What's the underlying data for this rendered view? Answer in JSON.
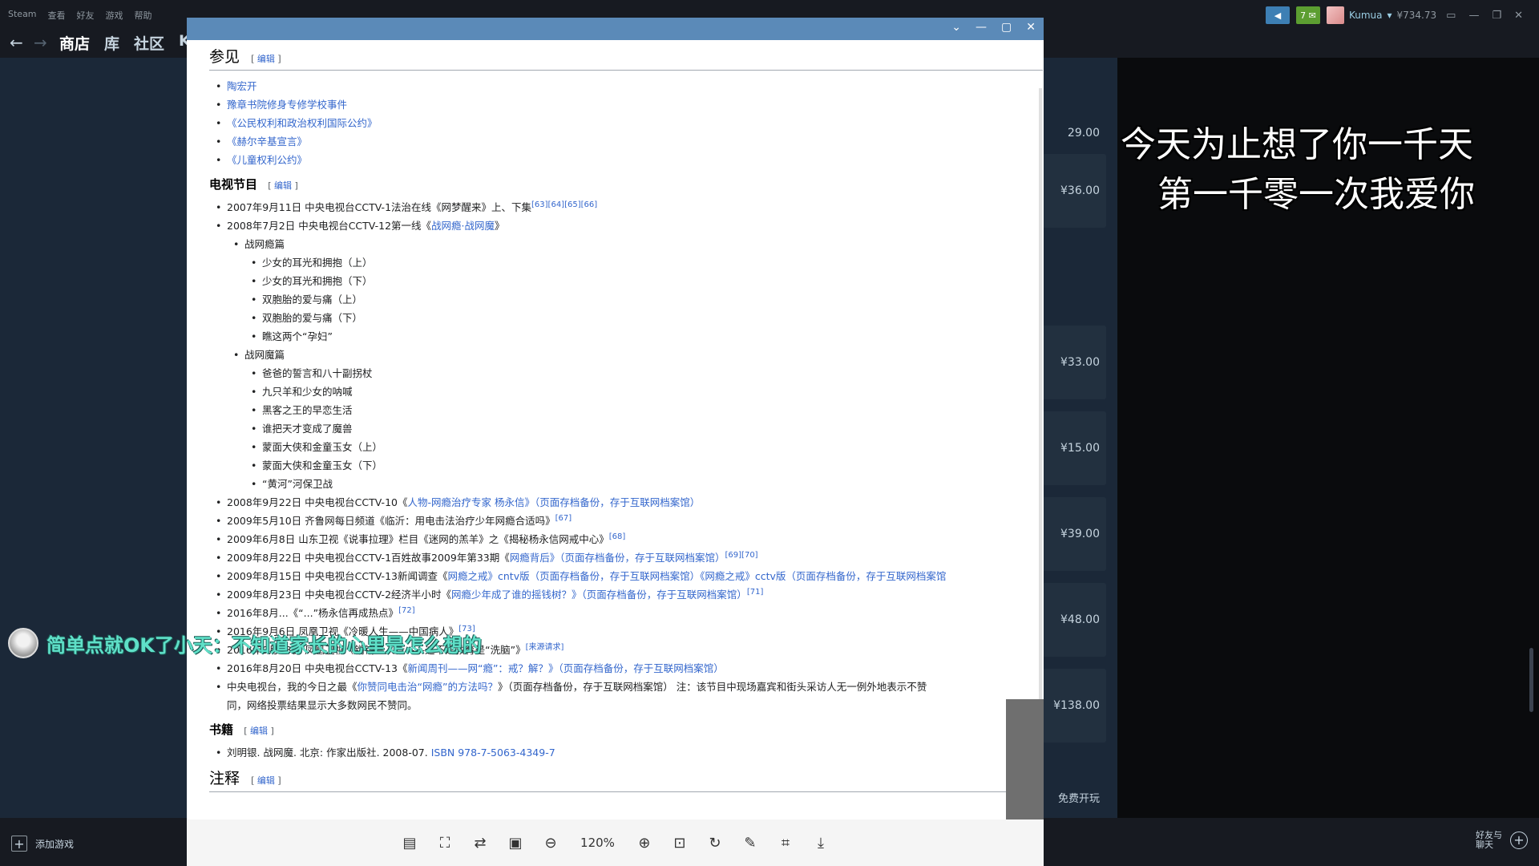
{
  "steam": {
    "menu": [
      "Steam",
      "查看",
      "好友",
      "游戏",
      "帮助"
    ],
    "back_arrow": "←",
    "forward_arrow": "→",
    "tabs": [
      "商店",
      "库",
      "社区",
      "K"
    ],
    "notifications": "7",
    "username": "Kumua",
    "wallet": "¥734.73",
    "prices": [
      "29.00",
      "¥36.00",
      "¥33.00",
      "¥15.00",
      "¥39.00",
      "¥48.00",
      "¥138.00",
      "免费开玩"
    ],
    "add_game": "添加游戏",
    "friends_chat_line1": "好友与",
    "friends_chat_line2": "聊天"
  },
  "lyrics": {
    "line1": "今天为止想了你一千天",
    "line2": "第一千零一次我爱你"
  },
  "danmaku": {
    "text": "简单点就OK了小天：不知道家长的心里是怎么想的"
  },
  "viewer": {
    "zoom": "120%",
    "controls": [
      "⌄",
      "—",
      "▢",
      "✕"
    ]
  },
  "wiki": {
    "edit_label": "编辑",
    "see_also": {
      "title": "参见",
      "items": [
        "陶宏开",
        "豫章书院修身专修学校事件",
        "《公民权利和政治权利国际公约》",
        "《赫尔辛基宣言》",
        "《儿童权利公约》"
      ]
    },
    "tv": {
      "title": "电视节目",
      "item1_text": "2007年9月11日 中央电视台CCTV-1法治在线《网梦醒来》上、下集",
      "item1_refs": "[63][64][65][66]",
      "item2_text": "2008年7月2日 中央电视台CCTV-12第一线《",
      "item2_link": "战网瘾·战网魔",
      "item2_end": "》",
      "sub1": "战网瘾篇",
      "sub1_items": [
        "少女的耳光和拥抱（上）",
        "少女的耳光和拥抱（下）",
        "双胞胎的爱与痛（上）",
        "双胞胎的爱与痛（下）",
        "瞧这两个“孕妇”"
      ],
      "sub2": "战网魔篇",
      "sub2_items": [
        "爸爸的誓言和八十副拐杖",
        "九只羊和少女的呐喊",
        "黑客之王的早恋生活",
        "谁把天才变成了魔兽",
        "蒙面大侠和金童玉女（上）",
        "蒙面大侠和金童玉女（下）",
        "“黄河”河保卫战"
      ],
      "item3_text": "2008年9月22日 中央电视台CCTV-10《",
      "item3_link": "人物-网瘾治疗专家 杨永信",
      "item3_end": "》（页面存档备份，存于互联网档案馆）",
      "item4_text": "2009年5月10日 齐鲁网每日频道《临沂：用电击法治疗少年网瘾合适吗》",
      "item4_ref": "[67]",
      "item5_text": "2009年6月8日 山东卫视《说事拉理》栏目《迷网的羔羊》之《揭秘杨永信网戒中心》",
      "item5_ref": "[68]",
      "item6_text": "2009年8月22日 中央电视台CCTV-1百姓故事2009年第33期《",
      "item6_link": "网瘾背后",
      "item6_end": "》（页面存档备份，存于互联网档案馆）",
      "item6_ref": "[69][70]",
      "item7_text": "2009年8月15日 中央电视台CCTV-13新闻调查《",
      "item7_link": "网瘾之戒",
      "item7_end": "》cntv版（页面存档备份，存于互联网档案馆）《网瘾之戒》cctv版（页面存档备份，存于互联网档案馆",
      "item8_text": "2009年8月23日 中央电视台CCTV-2经济半小时《",
      "item8_link": "网瘾少年成了谁的摇钱树？",
      "item8_end": "》（页面存档备份，存于互联网档案馆）",
      "item8_ref": "[71]",
      "item9_text": "2016年8月...《“...”杨永信再成热点》",
      "item9_ref": "[72]",
      "item10_text": "2016年9月6日 凤凰卫视《冷暖人生——中国病人》",
      "item10_ref": "[73]",
      "item11_text": "2016年9月23日 凤凰卫视《锵锵三人行——这不是教育是“洗脑”》",
      "item11_ref": "[来源请求]",
      "item12_text": "2016年8月20日 中央电视台CCTV-13《",
      "item12_link": "新闻周刊——网“瘾”：戒？解？",
      "item12_end": "》（页面存档备份，存于互联网档案馆）",
      "item13_text": "中央电视台，我的今日之最《",
      "item13_link": "你赞同电击治“网瘾”的方法吗？",
      "item13_end": "》（页面存档备份，存于互联网档案馆） 注：该节目中现场嘉宾和街头采访人无一例外地表示不赞",
      "item13_line2": "同，网络投票结果显示大多数网民不赞同。"
    },
    "books": {
      "title": "书籍",
      "item_text": "刘明银. 战网魔. 北京: 作家出版社. 2008-07. ",
      "item_isbn": "ISBN 978-7-5063-4349-7"
    },
    "notes": {
      "title": "注释"
    }
  }
}
